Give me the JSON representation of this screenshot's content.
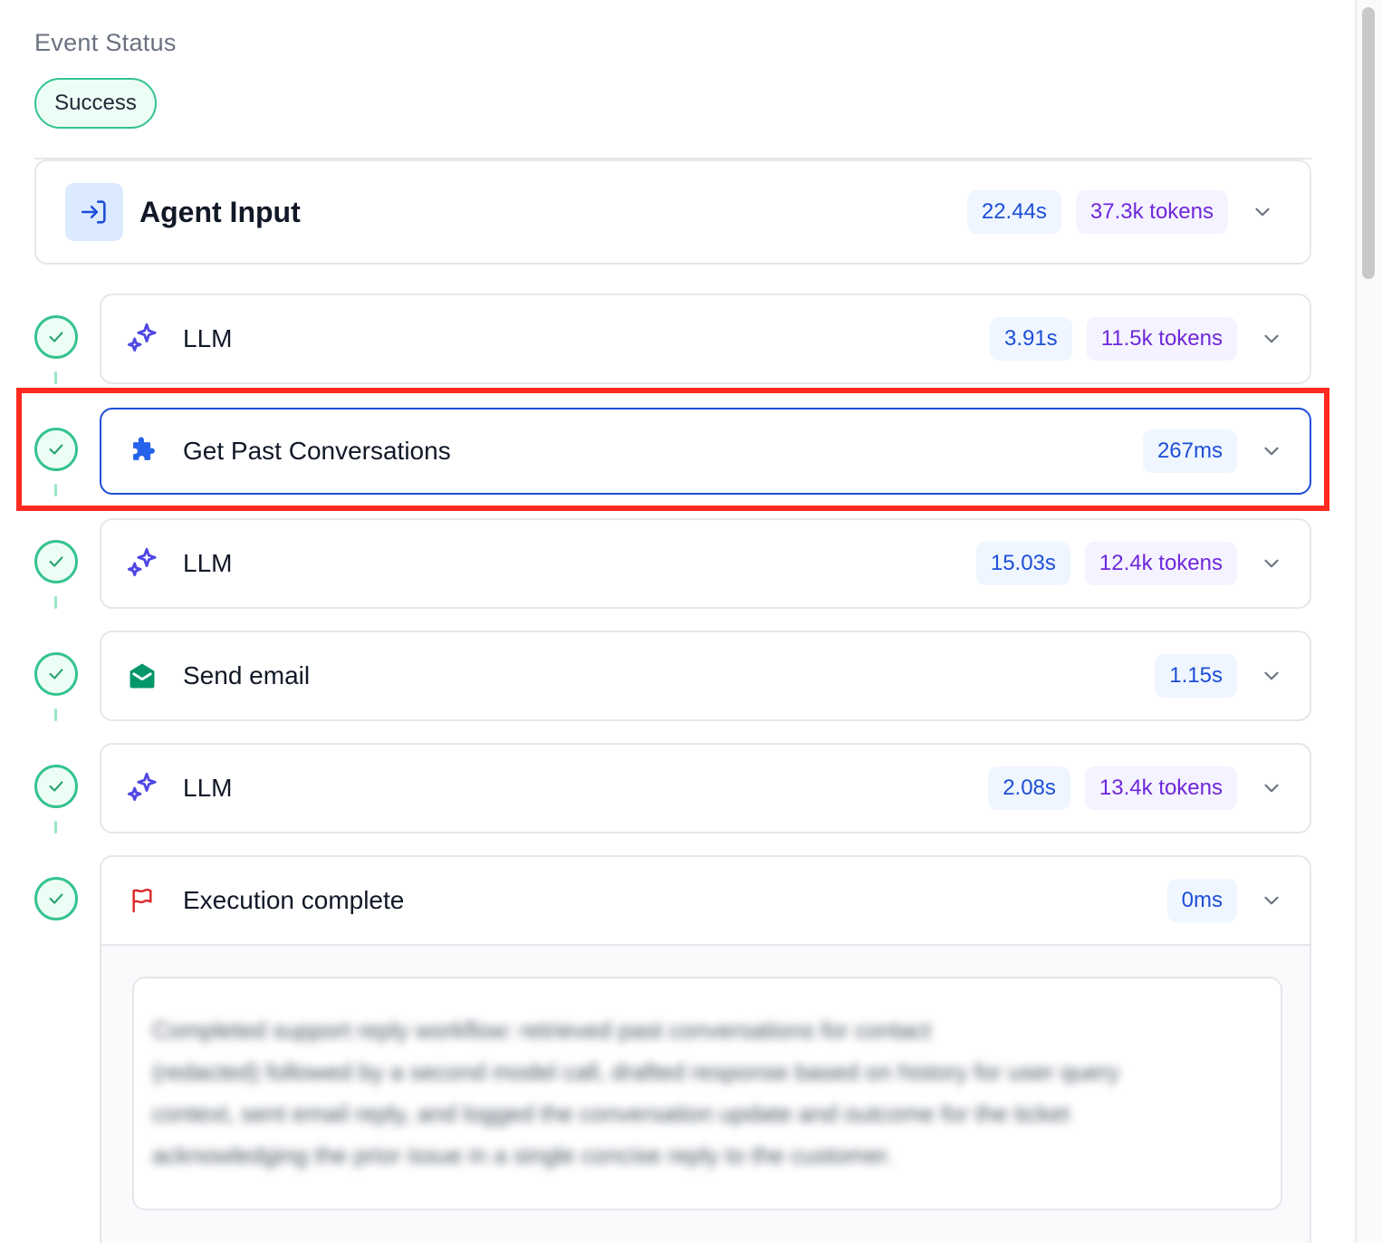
{
  "event_status": {
    "label": "Event Status",
    "value": "Success"
  },
  "agent_input": {
    "title": "Agent Input",
    "duration": "22.44s",
    "tokens": "37.3k tokens"
  },
  "steps": [
    {
      "title": "LLM",
      "icon": "sparkles-icon",
      "duration": "3.91s",
      "tokens": "11.5k tokens"
    },
    {
      "title": "Get Past Conversations",
      "icon": "puzzle-icon",
      "duration": "267ms",
      "selected": true
    },
    {
      "title": "LLM",
      "icon": "sparkles-icon",
      "duration": "15.03s",
      "tokens": "12.4k tokens"
    },
    {
      "title": "Send email",
      "icon": "envelope-open-icon",
      "duration": "1.15s"
    },
    {
      "title": "LLM",
      "icon": "sparkles-icon",
      "duration": "2.08s",
      "tokens": "13.4k tokens"
    },
    {
      "title": "Execution complete",
      "icon": "flag-icon",
      "duration": "0ms",
      "expanded": true
    }
  ],
  "execution_output": [
    "Completed support reply workflow: retrieved past conversations for contact",
    "(redacted) followed by a second model call, drafted response based on history for user query",
    "context, sent email reply, and logged the conversation update and outcome for the ticket",
    "acknowledging the prior issue in a single concise reply to the customer."
  ],
  "colors": {
    "success": "#34c38f",
    "time_badge_text": "#1d4ed8",
    "token_badge_text": "#6d28d9",
    "highlight": "#ff2a1f"
  }
}
